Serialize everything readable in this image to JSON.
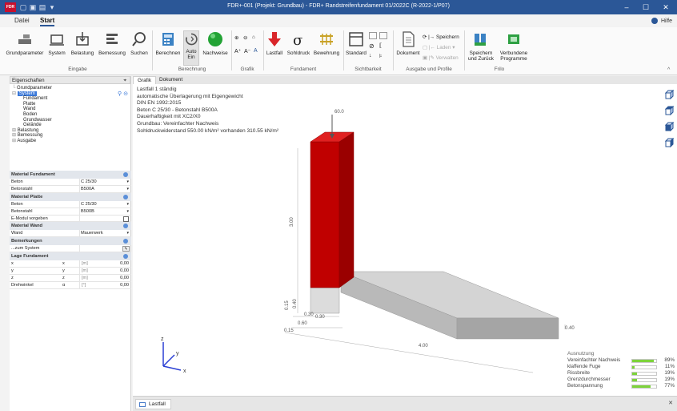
{
  "titlebar": {
    "logo": "FDR",
    "title": "FDR+-001 (Projekt: Grundbau) - FDR+ Randstreifenfundament 01/2022C (R-2022-1/P07)",
    "minimize": "–",
    "maximize": "☐",
    "close": "✕"
  },
  "menu": {
    "datei": "Datei",
    "start": "Start",
    "help": "Hilfe"
  },
  "ribbon": {
    "grundparameter": "Grundparameter",
    "system": "System",
    "belastung": "Belastung",
    "bemessung": "Bemessung",
    "suchen": "Suchen",
    "berechnen": "Berechnen",
    "auto": "Auto",
    "ein": "Ein",
    "nachweise": "Nachweise",
    "lastfall": "Lastfall",
    "sohldruck": "Sohldruck",
    "bewehrung": "Bewehrung",
    "standard": "Standard",
    "dokument": "Dokument",
    "speichern": "Speichern",
    "laden": "Laden",
    "verwalten": "Verwalten",
    "speichern_zurueck_1": "Speichern",
    "speichern_zurueck_2": "und Zurück",
    "verbundene_1": "Verbundene",
    "verbundene_2": "Programme",
    "groups": {
      "eingabe": "Eingabe",
      "berechnung": "Berechnung",
      "grafik": "Grafik",
      "fundament": "Fundament",
      "sichtbarkeit": "Sichtbarkeit",
      "ausgabe": "Ausgabe und Profile",
      "frilo": "Frilo"
    }
  },
  "panel": {
    "title": "Eigenschaften",
    "pin": "⌖",
    "tree": {
      "grundparameter": "Grundparameter",
      "system": "System",
      "fundament": "Fundament",
      "platte": "Platte",
      "wand": "Wand",
      "boden": "Boden",
      "grundwasser": "Grundwasser",
      "gelaende": "Gelände",
      "belastung": "Belastung",
      "bemessung": "Bemessung",
      "ausgabe": "Ausgabe"
    },
    "material_fundament": {
      "title": "Material Fundament",
      "beton_label": "Beton",
      "beton_value": "C 25/30",
      "stahl_label": "Betonstahl",
      "stahl_value": "B500A"
    },
    "material_platte": {
      "title": "Material Platte",
      "beton_label": "Beton",
      "beton_value": "C 25/30",
      "stahl_label": "Betonstahl",
      "stahl_value": "B500B",
      "emodul_label": "E-Modul vorgeben"
    },
    "material_wand": {
      "title": "Material Wand",
      "wand_label": "Wand",
      "wand_value": "Mauerwerk"
    },
    "bemerkungen": {
      "title": "Bemerkungen",
      "system_label": "...zum System"
    },
    "lage": {
      "title": "Lage Fundament",
      "rows": [
        {
          "label": "x",
          "sym": "x",
          "unit": "[m]",
          "value": "0,00"
        },
        {
          "label": "y",
          "sym": "y",
          "unit": "[m]",
          "value": "0,00"
        },
        {
          "label": "z",
          "sym": "z",
          "unit": "[m]",
          "value": "0,00"
        },
        {
          "label": "Drehwinkel",
          "sym": "α",
          "unit": "[°]",
          "value": "0,00"
        }
      ]
    }
  },
  "doc": {
    "tab_grafik": "Grafik",
    "tab_dokument": "Dokument",
    "info": [
      "Lastfall 1 ständig",
      "automatische Überlagerung mit Eigengewicht",
      "DIN EN 1992:2015",
      "Beton C 25/30 - Betonstahl B500A",
      "Dauerhaftigkeit mit XC2/X0",
      "Grundbau: Vereinfachter Nachweis",
      "Sohldruckwiderstand 550.00 kN/m² vorhanden 310.55 kN/m²"
    ],
    "dims": {
      "top": "60.0",
      "height": "3.00",
      "d040a": "0.40",
      "d015a": "0.15",
      "d030a": "0.30",
      "d030b": "0.30",
      "d060": "0.60",
      "d015b": "0.15",
      "length": "4.00",
      "right": "0.40"
    },
    "axes": {
      "x": "x",
      "y": "y",
      "z": "z"
    },
    "utilization": {
      "title": "Ausnutzung",
      "rows": [
        {
          "label": "Vereinfachter Nachweis",
          "pct": "89%",
          "fraction": 0.89
        },
        {
          "label": "klaffende Fuge",
          "pct": "11%",
          "fraction": 0.11
        },
        {
          "label": "Rissbreite",
          "pct": "19%",
          "fraction": 0.19
        },
        {
          "label": "Grenzdurchmesser",
          "pct": "19%",
          "fraction": 0.19
        },
        {
          "label": "Betonspannung",
          "pct": "77%",
          "fraction": 0.77
        }
      ]
    },
    "bottom_tab": "Lastfall",
    "bottom_close": "✕"
  },
  "colors": {
    "titlebar": "#2b5797",
    "wall": "#c00000",
    "slab": "#c8c8c8",
    "utilization_fill": "#7dd33b"
  }
}
